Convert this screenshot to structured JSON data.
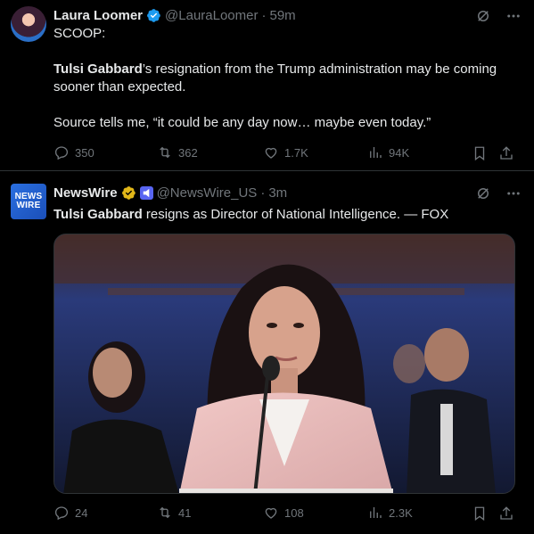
{
  "tweets": [
    {
      "name": "Laura Loomer",
      "handle": "@LauraLoomer",
      "sep": "·",
      "time": "59m",
      "lines": [
        "SCOOP:",
        "Tulsi Gabbard",
        "’s resignation from the Trump administration may be coming sooner than expected.",
        "Source tells me, “it could be any day now… maybe even today.”"
      ],
      "replies": "350",
      "retweets": "362",
      "likes": "1.7K",
      "views": "94K"
    },
    {
      "name": "NewsWire",
      "avatar_text_1": "NEWS",
      "avatar_text_2": "WIRE",
      "handle": "@NewsWire_US",
      "sep": "·",
      "time": "3m",
      "bold": "Tulsi Gabbard",
      "text": " resigns as Director of National Intelligence. — FOX",
      "replies": "24",
      "retweets": "41",
      "likes": "108",
      "views": "2.3K"
    }
  ],
  "colors": {
    "verified_blue": "#1d9bf0",
    "verified_gold": "#e2b719",
    "muted": "#71767b",
    "affiliate": "#5865f2"
  }
}
